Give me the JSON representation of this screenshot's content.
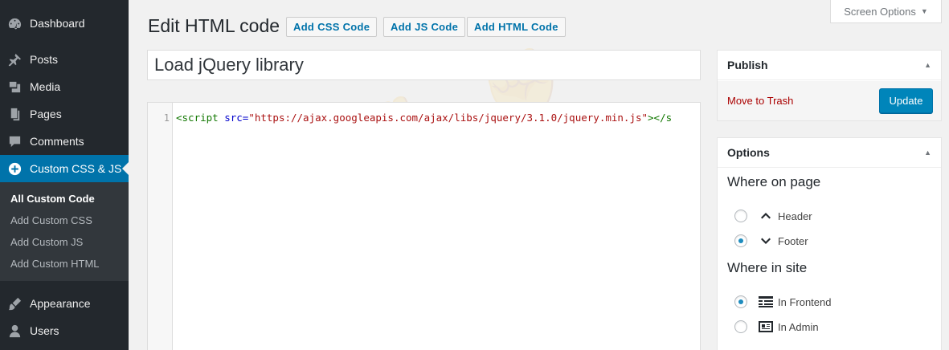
{
  "sidebar": {
    "items": [
      {
        "label": "Dashboard",
        "icon": "dashboard-icon"
      },
      {
        "label": "Posts",
        "icon": "pin-icon"
      },
      {
        "label": "Media",
        "icon": "media-icon"
      },
      {
        "label": "Pages",
        "icon": "pages-icon"
      },
      {
        "label": "Comments",
        "icon": "comment-icon"
      },
      {
        "label": "Custom CSS & JS",
        "icon": "plus-circle-icon"
      },
      {
        "label": "Appearance",
        "icon": "brush-icon"
      },
      {
        "label": "Users",
        "icon": "user-icon"
      }
    ],
    "submenu": [
      "All Custom Code",
      "Add Custom CSS",
      "Add Custom JS",
      "Add Custom HTML"
    ]
  },
  "header": {
    "title": "Edit HTML code",
    "buttons": [
      "Add CSS Code",
      "Add JS Code",
      "Add HTML Code"
    ],
    "screen_options": "Screen Options"
  },
  "post": {
    "title": "Load jQuery library"
  },
  "editor": {
    "line_number": "1",
    "tag_open": "<script",
    "attr": " src=",
    "value": "\"https://ajax.googleapis.com/ajax/libs/jquery/3.1.0/jquery.min.js\"",
    "tag_close": "></s"
  },
  "publish": {
    "heading": "Publish",
    "trash": "Move to Trash",
    "update": "Update"
  },
  "options": {
    "heading": "Options",
    "where_on_page": "Where on page",
    "header": "Header",
    "footer": "Footer",
    "where_in_site": "Where in site",
    "frontend": "In Frontend",
    "admin": "In Admin",
    "selected_position": "Footer",
    "selected_site": "In Frontend"
  },
  "colors": {
    "sidebar_bg": "#23282d",
    "accent": "#0073aa",
    "button_primary": "#0085ba",
    "trash": "#aa0000"
  }
}
